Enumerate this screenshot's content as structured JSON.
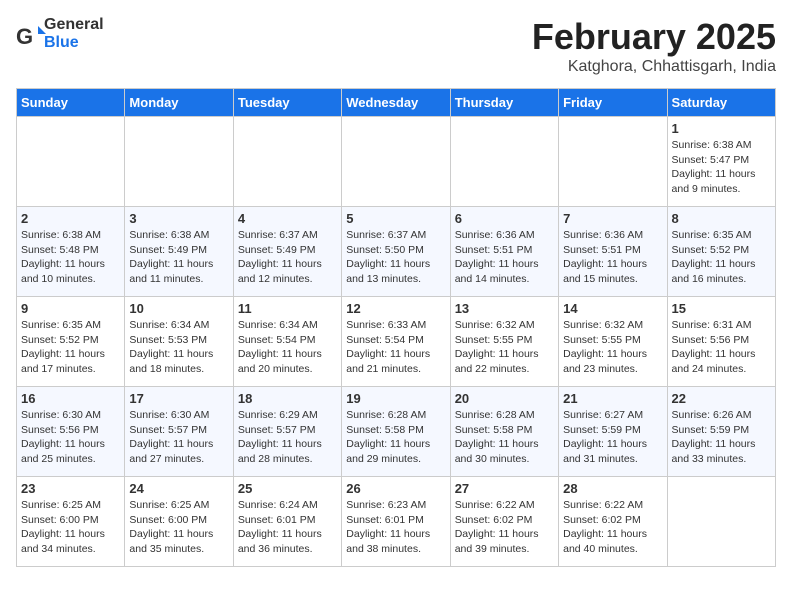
{
  "header": {
    "logo_general": "General",
    "logo_blue": "Blue",
    "title": "February 2025",
    "subtitle": "Katghora, Chhattisgarh, India"
  },
  "weekdays": [
    "Sunday",
    "Monday",
    "Tuesday",
    "Wednesday",
    "Thursday",
    "Friday",
    "Saturday"
  ],
  "weeks": [
    [
      {
        "day": "",
        "text": ""
      },
      {
        "day": "",
        "text": ""
      },
      {
        "day": "",
        "text": ""
      },
      {
        "day": "",
        "text": ""
      },
      {
        "day": "",
        "text": ""
      },
      {
        "day": "",
        "text": ""
      },
      {
        "day": "1",
        "text": "Sunrise: 6:38 AM\nSunset: 5:47 PM\nDaylight: 11 hours and 9 minutes."
      }
    ],
    [
      {
        "day": "2",
        "text": "Sunrise: 6:38 AM\nSunset: 5:48 PM\nDaylight: 11 hours and 10 minutes."
      },
      {
        "day": "3",
        "text": "Sunrise: 6:38 AM\nSunset: 5:49 PM\nDaylight: 11 hours and 11 minutes."
      },
      {
        "day": "4",
        "text": "Sunrise: 6:37 AM\nSunset: 5:49 PM\nDaylight: 11 hours and 12 minutes."
      },
      {
        "day": "5",
        "text": "Sunrise: 6:37 AM\nSunset: 5:50 PM\nDaylight: 11 hours and 13 minutes."
      },
      {
        "day": "6",
        "text": "Sunrise: 6:36 AM\nSunset: 5:51 PM\nDaylight: 11 hours and 14 minutes."
      },
      {
        "day": "7",
        "text": "Sunrise: 6:36 AM\nSunset: 5:51 PM\nDaylight: 11 hours and 15 minutes."
      },
      {
        "day": "8",
        "text": "Sunrise: 6:35 AM\nSunset: 5:52 PM\nDaylight: 11 hours and 16 minutes."
      }
    ],
    [
      {
        "day": "9",
        "text": "Sunrise: 6:35 AM\nSunset: 5:52 PM\nDaylight: 11 hours and 17 minutes."
      },
      {
        "day": "10",
        "text": "Sunrise: 6:34 AM\nSunset: 5:53 PM\nDaylight: 11 hours and 18 minutes."
      },
      {
        "day": "11",
        "text": "Sunrise: 6:34 AM\nSunset: 5:54 PM\nDaylight: 11 hours and 20 minutes."
      },
      {
        "day": "12",
        "text": "Sunrise: 6:33 AM\nSunset: 5:54 PM\nDaylight: 11 hours and 21 minutes."
      },
      {
        "day": "13",
        "text": "Sunrise: 6:32 AM\nSunset: 5:55 PM\nDaylight: 11 hours and 22 minutes."
      },
      {
        "day": "14",
        "text": "Sunrise: 6:32 AM\nSunset: 5:55 PM\nDaylight: 11 hours and 23 minutes."
      },
      {
        "day": "15",
        "text": "Sunrise: 6:31 AM\nSunset: 5:56 PM\nDaylight: 11 hours and 24 minutes."
      }
    ],
    [
      {
        "day": "16",
        "text": "Sunrise: 6:30 AM\nSunset: 5:56 PM\nDaylight: 11 hours and 25 minutes."
      },
      {
        "day": "17",
        "text": "Sunrise: 6:30 AM\nSunset: 5:57 PM\nDaylight: 11 hours and 27 minutes."
      },
      {
        "day": "18",
        "text": "Sunrise: 6:29 AM\nSunset: 5:57 PM\nDaylight: 11 hours and 28 minutes."
      },
      {
        "day": "19",
        "text": "Sunrise: 6:28 AM\nSunset: 5:58 PM\nDaylight: 11 hours and 29 minutes."
      },
      {
        "day": "20",
        "text": "Sunrise: 6:28 AM\nSunset: 5:58 PM\nDaylight: 11 hours and 30 minutes."
      },
      {
        "day": "21",
        "text": "Sunrise: 6:27 AM\nSunset: 5:59 PM\nDaylight: 11 hours and 31 minutes."
      },
      {
        "day": "22",
        "text": "Sunrise: 6:26 AM\nSunset: 5:59 PM\nDaylight: 11 hours and 33 minutes."
      }
    ],
    [
      {
        "day": "23",
        "text": "Sunrise: 6:25 AM\nSunset: 6:00 PM\nDaylight: 11 hours and 34 minutes."
      },
      {
        "day": "24",
        "text": "Sunrise: 6:25 AM\nSunset: 6:00 PM\nDaylight: 11 hours and 35 minutes."
      },
      {
        "day": "25",
        "text": "Sunrise: 6:24 AM\nSunset: 6:01 PM\nDaylight: 11 hours and 36 minutes."
      },
      {
        "day": "26",
        "text": "Sunrise: 6:23 AM\nSunset: 6:01 PM\nDaylight: 11 hours and 38 minutes."
      },
      {
        "day": "27",
        "text": "Sunrise: 6:22 AM\nSunset: 6:02 PM\nDaylight: 11 hours and 39 minutes."
      },
      {
        "day": "28",
        "text": "Sunrise: 6:22 AM\nSunset: 6:02 PM\nDaylight: 11 hours and 40 minutes."
      },
      {
        "day": "",
        "text": ""
      }
    ]
  ]
}
